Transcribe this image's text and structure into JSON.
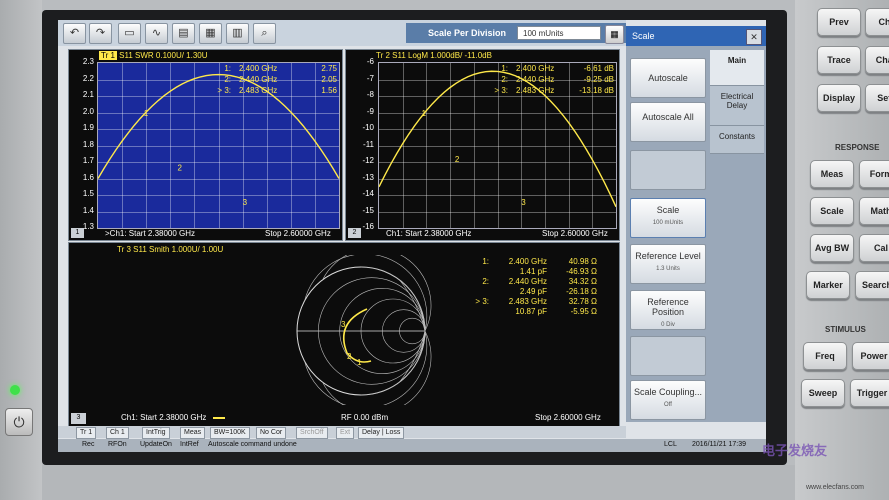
{
  "toolbar": {
    "icons": [
      "undo-icon",
      "redo-icon",
      "folder-icon",
      "marker-icon",
      "print-icon",
      "save-icon",
      "trash-icon",
      "zoom-icon"
    ],
    "scale_per_division_label": "Scale Per Division",
    "scale_per_division_value": "100 mUnits"
  },
  "trace1": {
    "title_tr": "Tr 1",
    "title": "S11 SWR 0.100U/  1.30U",
    "y_ticks": [
      "2.3",
      "2.2",
      "2.1",
      "2.0",
      "1.9",
      "1.8",
      "1.7",
      "1.6",
      "1.5",
      "1.4",
      "1.3"
    ],
    "markers": [
      {
        "id": "1:",
        "freq": "2.400  GHz",
        "val": "2.75"
      },
      {
        "id": "2:",
        "freq": "2.440  GHz",
        "val": "2.05"
      },
      {
        "id": "> 3:",
        "freq": "2.483  GHz",
        "val": "1.56"
      }
    ],
    "start": ">Ch1:  Start  2.38000 GHz",
    "stop": "Stop  2.60000 GHz",
    "pane": "1"
  },
  "trace2": {
    "title_tr": "Tr 2",
    "title": "S11 LogM 1.000dB/ -11.0dB",
    "y_ticks": [
      "-6",
      "-7",
      "-8",
      "-9",
      "-10",
      "-11",
      "-12",
      "-13",
      "-14",
      "-15",
      "-16"
    ],
    "markers": [
      {
        "id": "1:",
        "freq": "2.400  GHz",
        "val": "-6.61 dB"
      },
      {
        "id": "2:",
        "freq": "2.440  GHz",
        "val": "-9.25 dB"
      },
      {
        "id": "> 3:",
        "freq": "2.483  GHz",
        "val": "-13.18 dB"
      }
    ],
    "start": "Ch1:  Start  2.38000 GHz",
    "stop": "Stop  2.60000 GHz",
    "pane": "2"
  },
  "trace3": {
    "title": "Tr 3  S11 Smith 1.000U/  1.00U",
    "markers": [
      {
        "id": "1:",
        "freq": "2.400  GHz",
        "val": "40.98 Ω"
      },
      {
        "id": "",
        "freq": "1.41 pF",
        "val": "-46.93 Ω"
      },
      {
        "id": "2:",
        "freq": "2.440  GHz",
        "val": "34.32 Ω"
      },
      {
        "id": "",
        "freq": "2.49 pF",
        "val": "-26.18 Ω"
      },
      {
        "id": "> 3:",
        "freq": "2.483  GHz",
        "val": "32.78 Ω"
      },
      {
        "id": "",
        "freq": "10.87 pF",
        "val": "-5.95 Ω"
      }
    ],
    "start": "Ch1:  Start  2.38000 GHz",
    "power": "RF   0.00  dBm",
    "stop": "Stop  2.60000 GHz",
    "pane": "3"
  },
  "scale_panel": {
    "title": "Scale",
    "close": "✕",
    "tabs": [
      "Main",
      "Electrical Delay",
      "Constants"
    ],
    "buttons": [
      {
        "label": "Autoscale",
        "sub": ""
      },
      {
        "label": "Autoscale All",
        "sub": ""
      },
      {
        "label": "",
        "sub": ""
      },
      {
        "label": "Scale",
        "sub": "100 mUnits"
      },
      {
        "label": "Reference Level",
        "sub": "1.3 Units"
      },
      {
        "label": "Reference Position",
        "sub": "0 Div"
      },
      {
        "label": "",
        "sub": ""
      },
      {
        "label": "Scale Coupling...",
        "sub": "Off"
      }
    ]
  },
  "status_bar": {
    "cells": [
      "Tr 1",
      "Ch 1",
      "IntTrig",
      "Meas",
      "BW=100K",
      "No Cor",
      "SrchOff",
      "Ext",
      "Delay | Loss"
    ],
    "row2": [
      "Rec",
      "RFOn",
      "UpdateOn",
      "IntRef",
      "Autoscale command undone"
    ],
    "lcl": "LCL",
    "datetime": "2016/11/21 17:39"
  },
  "hardware": {
    "buttons": [
      "Prev",
      "Cha",
      "Trace",
      "Chan",
      "Display",
      "Setu",
      "Meas",
      "Form",
      "Scale",
      "Math",
      "Avg BW",
      "Cal",
      "Marker",
      "Search",
      "Freq",
      "Power",
      "Sweep",
      "Trigger"
    ],
    "labels": [
      "RESPONSE",
      "STIMULUS"
    ]
  },
  "watermark": "电子发烧友",
  "watermark_url": "www.elecfans.com"
}
